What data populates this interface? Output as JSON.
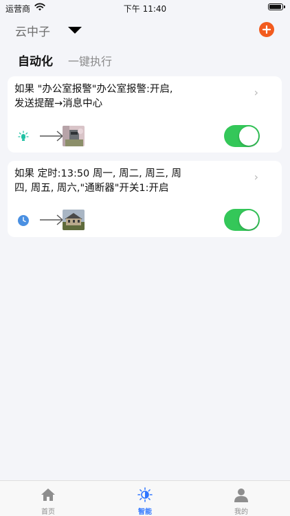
{
  "status_bar": {
    "carrier": "运营商",
    "time": "下午 11:40",
    "battery_level": 1.0
  },
  "header": {
    "home_name": "云中子",
    "caret_icon": "triangle-down-icon",
    "add_icon": "plus-circle-icon",
    "accent_color": "#f25b1e"
  },
  "tabs": [
    {
      "label": "自动化",
      "active": true
    },
    {
      "label": "一键执行",
      "active": false
    }
  ],
  "automations": [
    {
      "condition_text": "如果 \"办公室报警\"办公室报警:开启,",
      "action_text": "发送提醒→消息中心",
      "condition_icon": "sensor-icon",
      "target_icon": "room-photo",
      "enabled": true
    },
    {
      "condition_text": "如果 定时:13:50 周一, 周二, 周三, 周",
      "action_text": "四, 周五, 周六,\"通断器\"开关1:开启",
      "condition_icon": "clock-icon",
      "target_icon": "house-photo",
      "enabled": true
    }
  ],
  "bottom_nav": [
    {
      "label": "首页",
      "icon": "home-icon",
      "active": false
    },
    {
      "label": "智能",
      "icon": "smart-icon",
      "active": true
    },
    {
      "label": "我的",
      "icon": "user-icon",
      "active": false
    }
  ],
  "colors": {
    "toggle_on": "#34c759",
    "nav_active": "#2f76ff",
    "background": "#f4f5f9"
  }
}
